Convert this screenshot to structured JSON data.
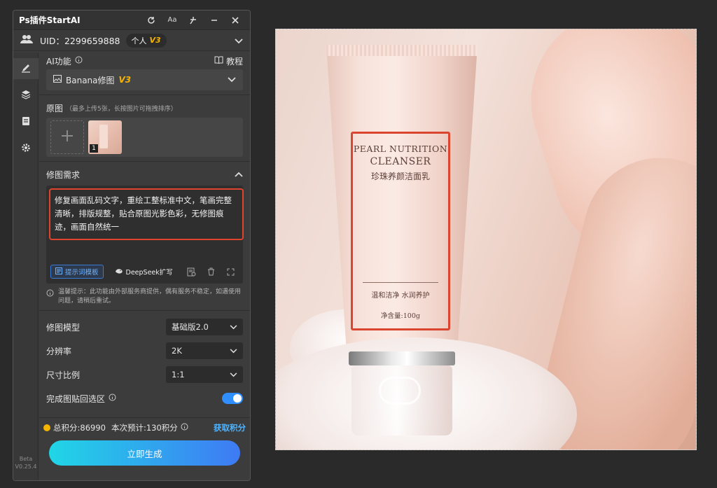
{
  "app": {
    "title": "Ps插件StartAI"
  },
  "user": {
    "uid_text": "UID：2299659888",
    "plan": "个人",
    "plan_version": "V3"
  },
  "ai": {
    "section_label": "AI功能",
    "tutorial_label": "教程",
    "feature_name": "Banana修图",
    "feature_version": "V3"
  },
  "source": {
    "label": "原图",
    "hint": "（最多上传5张，长按图片可拖拽排序）",
    "thumb_index": "1"
  },
  "requirements": {
    "label": "修图需求",
    "text": "修复画面乱码文字，重绘工整标准中文，笔画完整清晰，排版规整，贴合原图光影色彩，无修图痕迹，画面自然统一",
    "template_btn": "提示词模板",
    "deepseek_btn": "DeepSeek扩写"
  },
  "notice": "温馨提示：此功能由外部服务商提供，偶有服务不稳定，如遇使用问题，请稍后重试。",
  "options": {
    "model_label": "修图模型",
    "model_value": "基础版2.0",
    "resolution_label": "分辨率",
    "resolution_value": "2K",
    "ratio_label": "尺寸比例",
    "ratio_value": "1:1",
    "paste_back_label": "完成图贴回选区"
  },
  "credits": {
    "total": "总积分:86990",
    "estimate": "本次预计:130积分",
    "get_label": "获取积分"
  },
  "generate_label": "立即生成",
  "version": {
    "beta": "Beta",
    "number": "V0.25.4"
  },
  "product": {
    "name_en_line1": "PEARL NUTRITION",
    "name_en_line2": "CLEANSER",
    "name_cn": "珍珠养颜洁面乳",
    "subtitle": "温和洁净  水润养护",
    "net": "净含量:100g"
  },
  "colors": {
    "accent_red": "#d9452e",
    "toggle_blue": "#2f8fff",
    "link_blue": "#4fb4ff",
    "v3_gold": "#f5b400"
  }
}
